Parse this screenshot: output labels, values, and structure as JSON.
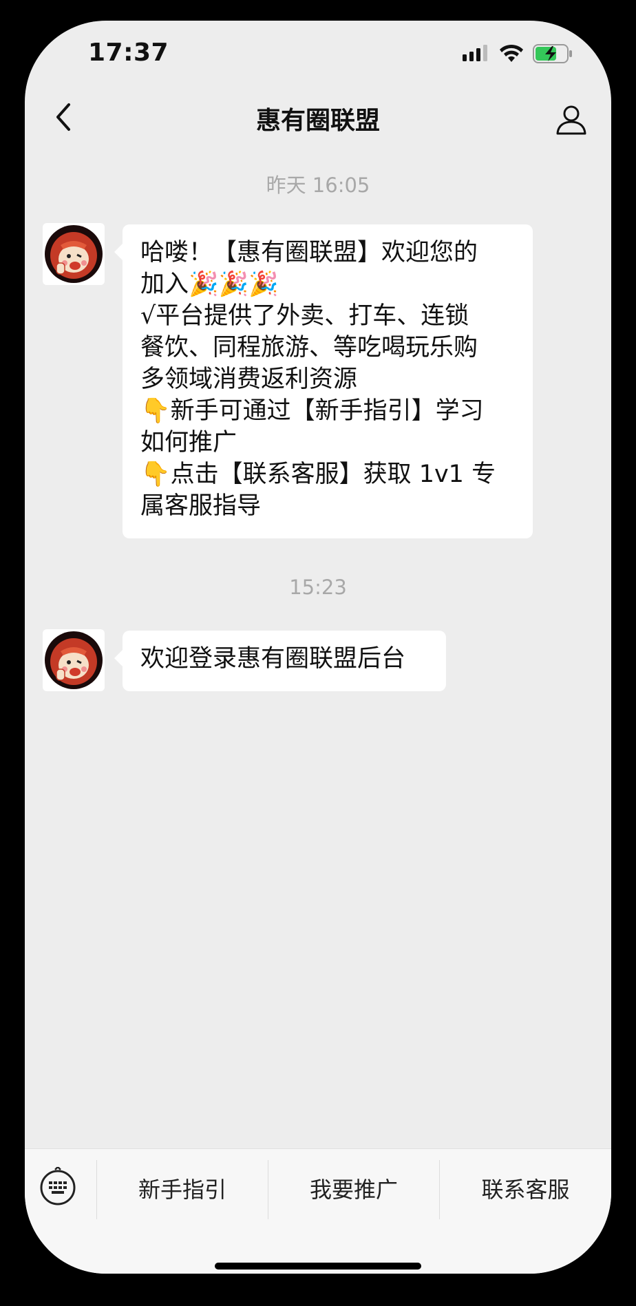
{
  "status_bar": {
    "time": "17:37"
  },
  "nav": {
    "title": "惠有圈联盟"
  },
  "messages": [
    {
      "time": "昨天 16:05",
      "lines": [
        "哈喽！【惠有圈联盟】欢迎您的",
        "加入🎉🎉🎉",
        "√平台提供了外卖、打车、连锁",
        "餐饮、同程旅游、等吃喝玩乐购",
        "多领域消费返利资源",
        "👇新手可通过【新手指引】学习",
        "如何推广",
        "👇点击【联系客服】获取 1v1 专",
        "属客服指导"
      ]
    },
    {
      "time": "15:23",
      "lines": [
        "欢迎登录惠有圈联盟后台"
      ]
    }
  ],
  "menu": {
    "items": [
      "新手指引",
      "我要推广",
      "联系客服"
    ]
  },
  "colors": {
    "background": "#ededed",
    "bubble": "#ffffff",
    "battery": "#34c759"
  }
}
